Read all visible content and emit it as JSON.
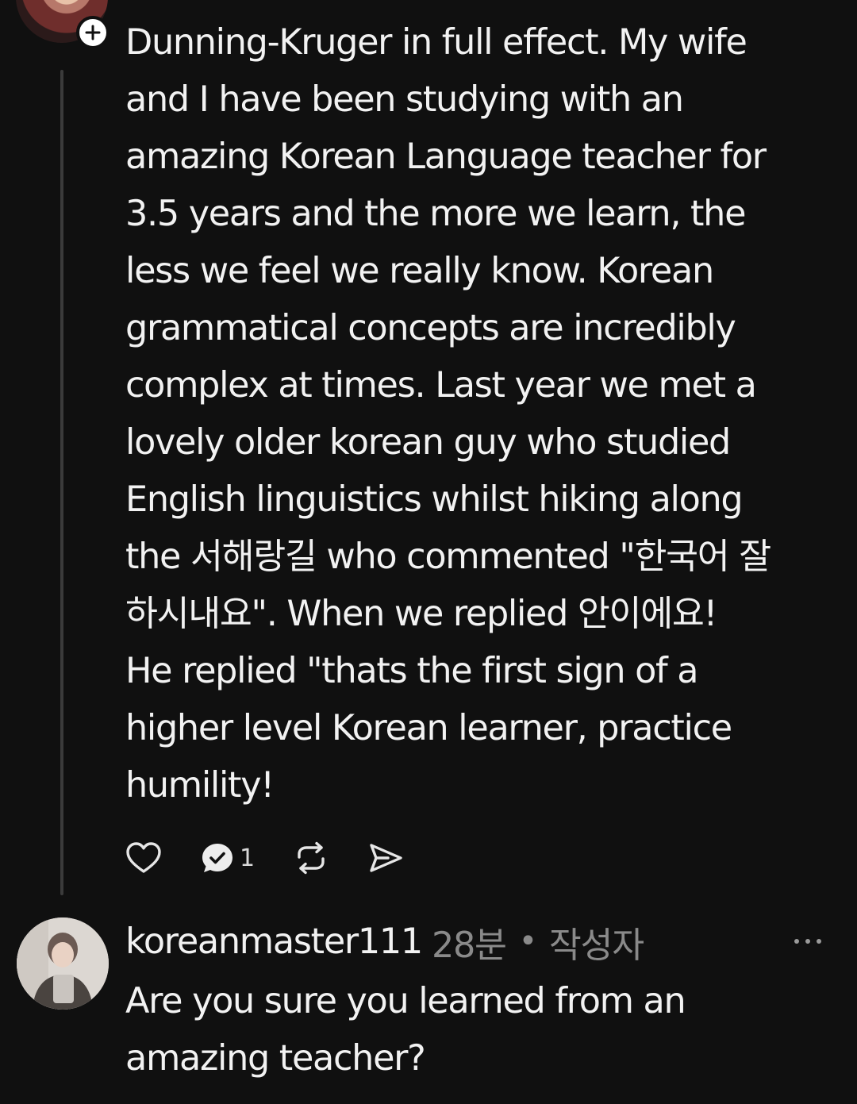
{
  "parent_post": {
    "body": "Dunning-Kruger in full effect. My wife\nand I have been studying with an\namazing Korean Language teacher for\n3.5 years and the more we learn, the\nless we feel we really know. Korean\ngrammatical concepts are incredibly\ncomplex at times. Last year we met a\nlovely older korean guy who studied\nEnglish linguistics whilst hiking along\nthe 서해랑길 who commented \"한국어 잘\n하시내요\". When we replied 안이에요!\nHe replied \"thats the first sign of a\nhigher level Korean learner, practice\nhumility!",
    "actions": {
      "like_icon": "heart-icon",
      "comment_icon": "comment-icon",
      "comment_count": "1",
      "repost_icon": "repost-icon",
      "share_icon": "send-icon"
    },
    "follow_icon": "plus-icon"
  },
  "reply": {
    "username": "koreanmaster111",
    "time": "28분",
    "separator": "•",
    "author_tag": "작성자",
    "more_icon": "more-icon",
    "text": "Are you sure you learned from an\namazing teacher?"
  },
  "colors": {
    "background": "#101010",
    "text": "#f2f2f2",
    "secondary_text": "#8a8a8a",
    "thread_line": "#3b3b3b"
  }
}
